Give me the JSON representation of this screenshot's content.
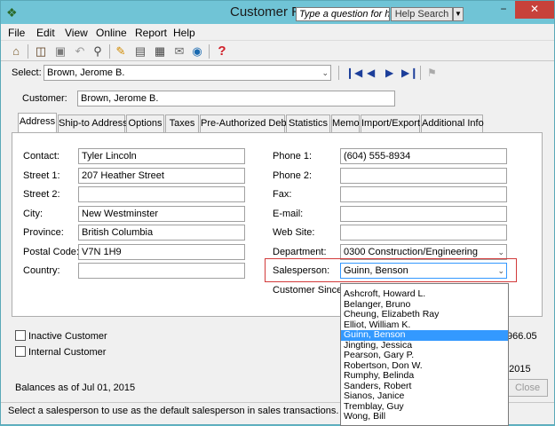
{
  "window": {
    "title": "Customer Re",
    "question_placeholder": "Type a question for help",
    "help_search": "Help Search",
    "minimize": "−",
    "maximize": "□",
    "close": "✕"
  },
  "menu": [
    "File",
    "Edit",
    "View",
    "Online",
    "Report",
    "Help"
  ],
  "toolbar_icons": [
    "home-icon",
    "open-icon",
    "save-icon",
    "undo-icon",
    "find-icon",
    "edit-icon",
    "notes-icon",
    "calculator-icon",
    "email-icon",
    "web-icon",
    "help-icon"
  ],
  "select": {
    "label": "Select:",
    "value": "Brown, Jerome B."
  },
  "customer": {
    "label": "Customer:",
    "value": "Brown, Jerome B."
  },
  "tabs": [
    "Address",
    "Ship-to Address",
    "Options",
    "Taxes",
    "Pre-Authorized Debit",
    "Statistics",
    "Memo",
    "Import/Export",
    "Additional Info"
  ],
  "address": {
    "contact_label": "Contact:",
    "contact": "Tyler Lincoln",
    "street1_label": "Street 1:",
    "street1": "207 Heather Street",
    "street2_label": "Street 2:",
    "street2": "",
    "city_label": "City:",
    "city": "New Westminster",
    "province_label": "Province:",
    "province": "British Columbia",
    "postal_label": "Postal Code:",
    "postal": "V7N 1H9",
    "country_label": "Country:",
    "country": "",
    "phone1_label": "Phone 1:",
    "phone1": "(604) 555-8934",
    "phone2_label": "Phone 2:",
    "phone2": "",
    "fax_label": "Fax:",
    "fax": "",
    "email_label": "E-mail:",
    "email": "",
    "website_label": "Web Site:",
    "website": "",
    "department_label": "Department:",
    "department": "0300 Construction/Engineering",
    "salesperson_label": "Salesperson:",
    "salesperson": "Guinn, Benson",
    "customer_since_label": "Customer Since:"
  },
  "salesperson_options": [
    "Ashcroft, Howard L.",
    "Belanger, Bruno",
    "Cheung, Elizabeth Ray",
    "Elliot, William K.",
    "Guinn, Benson",
    "Jingting, Jessica",
    "Pearson, Gary P.",
    "Robertson, Don W.",
    "Rumphy, Belinda",
    "Sanders, Robert",
    "Sianos, Janice",
    "Tremblay, Guy",
    "Wong, Bill"
  ],
  "flags": {
    "inactive_label": "Inactive Customer",
    "internal_label": "Internal Customer"
  },
  "balances": {
    "label": "Balances as of Jul 01, 2015",
    "value1": "966.05",
    "value2": ", 2015"
  },
  "close_label": "Close",
  "status": "Select a salesperson to use as the default salesperson in sales transactions."
}
